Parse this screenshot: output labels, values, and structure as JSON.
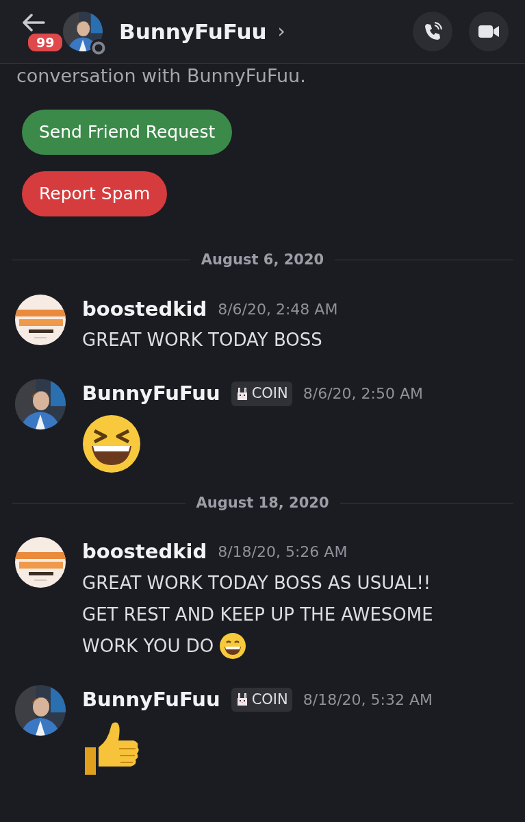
{
  "header": {
    "badge": "99",
    "title": "BunnyFuFuu",
    "chevron": "›"
  },
  "intro": "conversation with BunnyFuFuu.",
  "actions": [
    {
      "label": "Send Friend Request",
      "kind": "success"
    },
    {
      "label": "Report Spam",
      "kind": "danger"
    }
  ],
  "stream": [
    {
      "kind": "divider",
      "label": "August 6, 2020"
    },
    {
      "kind": "message",
      "author": "boostedkid",
      "avatar": {
        "kind": "logo"
      },
      "time": "8/6/20, 2:48 AM",
      "lines": [
        "GREAT WORK TODAY BOSS"
      ]
    },
    {
      "kind": "message",
      "author": "BunnyFuFuu",
      "tag": "COIN",
      "time": "8/6/20, 2:50 AM",
      "jumbo": {
        "kind": "laughing"
      }
    },
    {
      "kind": "divider",
      "label": "August 18, 2020"
    },
    {
      "kind": "message",
      "author": "boostedkid",
      "avatar": {
        "kind": "logo"
      },
      "time": "8/18/20, 5:26 AM",
      "lines": [
        "GREAT WORK TODAY BOSS AS USUAL!!",
        "GET REST AND KEEP UP THE AWESOME",
        "WORK YOU DO"
      ],
      "trailing_emoji": true
    },
    {
      "kind": "message",
      "author": "BunnyFuFuu",
      "tag": "COIN",
      "time": "8/18/20, 5:32 AM",
      "jumbo": {
        "kind": "thumbs"
      }
    }
  ]
}
